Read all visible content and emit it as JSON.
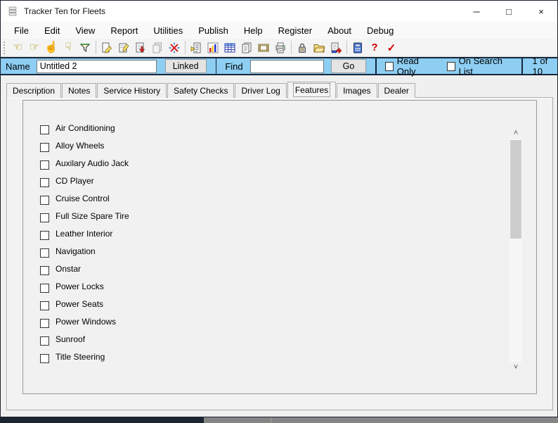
{
  "window": {
    "title": "Tracker Ten for Fleets",
    "minimize_glyph": "─",
    "maximize_glyph": "□",
    "close_glyph": "×"
  },
  "menu": {
    "items": [
      "File",
      "Edit",
      "View",
      "Report",
      "Utilities",
      "Publish",
      "Help",
      "Register",
      "About",
      "Debug"
    ]
  },
  "toolbar": {
    "icons": [
      {
        "name": "prev-record",
        "glyph": "☜"
      },
      {
        "name": "next-record",
        "glyph": "☞"
      },
      {
        "name": "first-record",
        "glyph": "☝"
      },
      {
        "name": "last-record",
        "glyph": "☟"
      },
      {
        "name": "filter"
      },
      {
        "name": "edit-record"
      },
      {
        "name": "new-record"
      },
      {
        "name": "save-record"
      },
      {
        "name": "copy-record"
      },
      {
        "name": "delete-record"
      },
      {
        "name": "find-record"
      },
      {
        "name": "report-chart"
      },
      {
        "name": "table-view"
      },
      {
        "name": "copy-pages"
      },
      {
        "name": "images"
      },
      {
        "name": "print"
      },
      {
        "name": "lock"
      },
      {
        "name": "open-file"
      },
      {
        "name": "export"
      },
      {
        "name": "calculator"
      },
      {
        "name": "help",
        "glyph": "?"
      },
      {
        "name": "spell-check",
        "glyph": "✓"
      }
    ]
  },
  "record_bar": {
    "name_label": "Name",
    "name_value": "Untitled 2",
    "linked_button": "Linked",
    "find_label": "Find",
    "find_value": "",
    "go_button": "Go",
    "read_only_label": "Read Only",
    "on_search_list_label": "On Search List",
    "position_text": "1 of 10",
    "background": "#8DCEF2"
  },
  "tabs": {
    "items": [
      "Description",
      "Notes",
      "Service History",
      "Safety Checks",
      "Driver Log",
      "Features",
      "Images",
      "Dealer"
    ],
    "active": "Features"
  },
  "features": {
    "items": [
      {
        "label": "Air Conditioning",
        "checked": false
      },
      {
        "label": "Alloy Wheels",
        "checked": false
      },
      {
        "label": "Auxilary Audio Jack",
        "checked": false
      },
      {
        "label": "CD Player",
        "checked": false
      },
      {
        "label": "Cruise Control",
        "checked": false
      },
      {
        "label": "Full Size Spare Tire",
        "checked": false
      },
      {
        "label": "Leather Interior",
        "checked": false
      },
      {
        "label": "Navigation",
        "checked": false
      },
      {
        "label": "Onstar",
        "checked": false
      },
      {
        "label": "Power Locks",
        "checked": false
      },
      {
        "label": "Power Seats",
        "checked": false
      },
      {
        "label": "Power Windows",
        "checked": false
      },
      {
        "label": "Sunroof",
        "checked": false
      },
      {
        "label": "Title Steering",
        "checked": false
      }
    ]
  },
  "scrollbar": {
    "up_glyph": "˄",
    "down_glyph": "˅"
  },
  "colors": {
    "record_bar_bg": "#8DCEF2",
    "separator": "#16263C",
    "accent_red": "#D40000",
    "thumb": "#CDCDCD"
  }
}
